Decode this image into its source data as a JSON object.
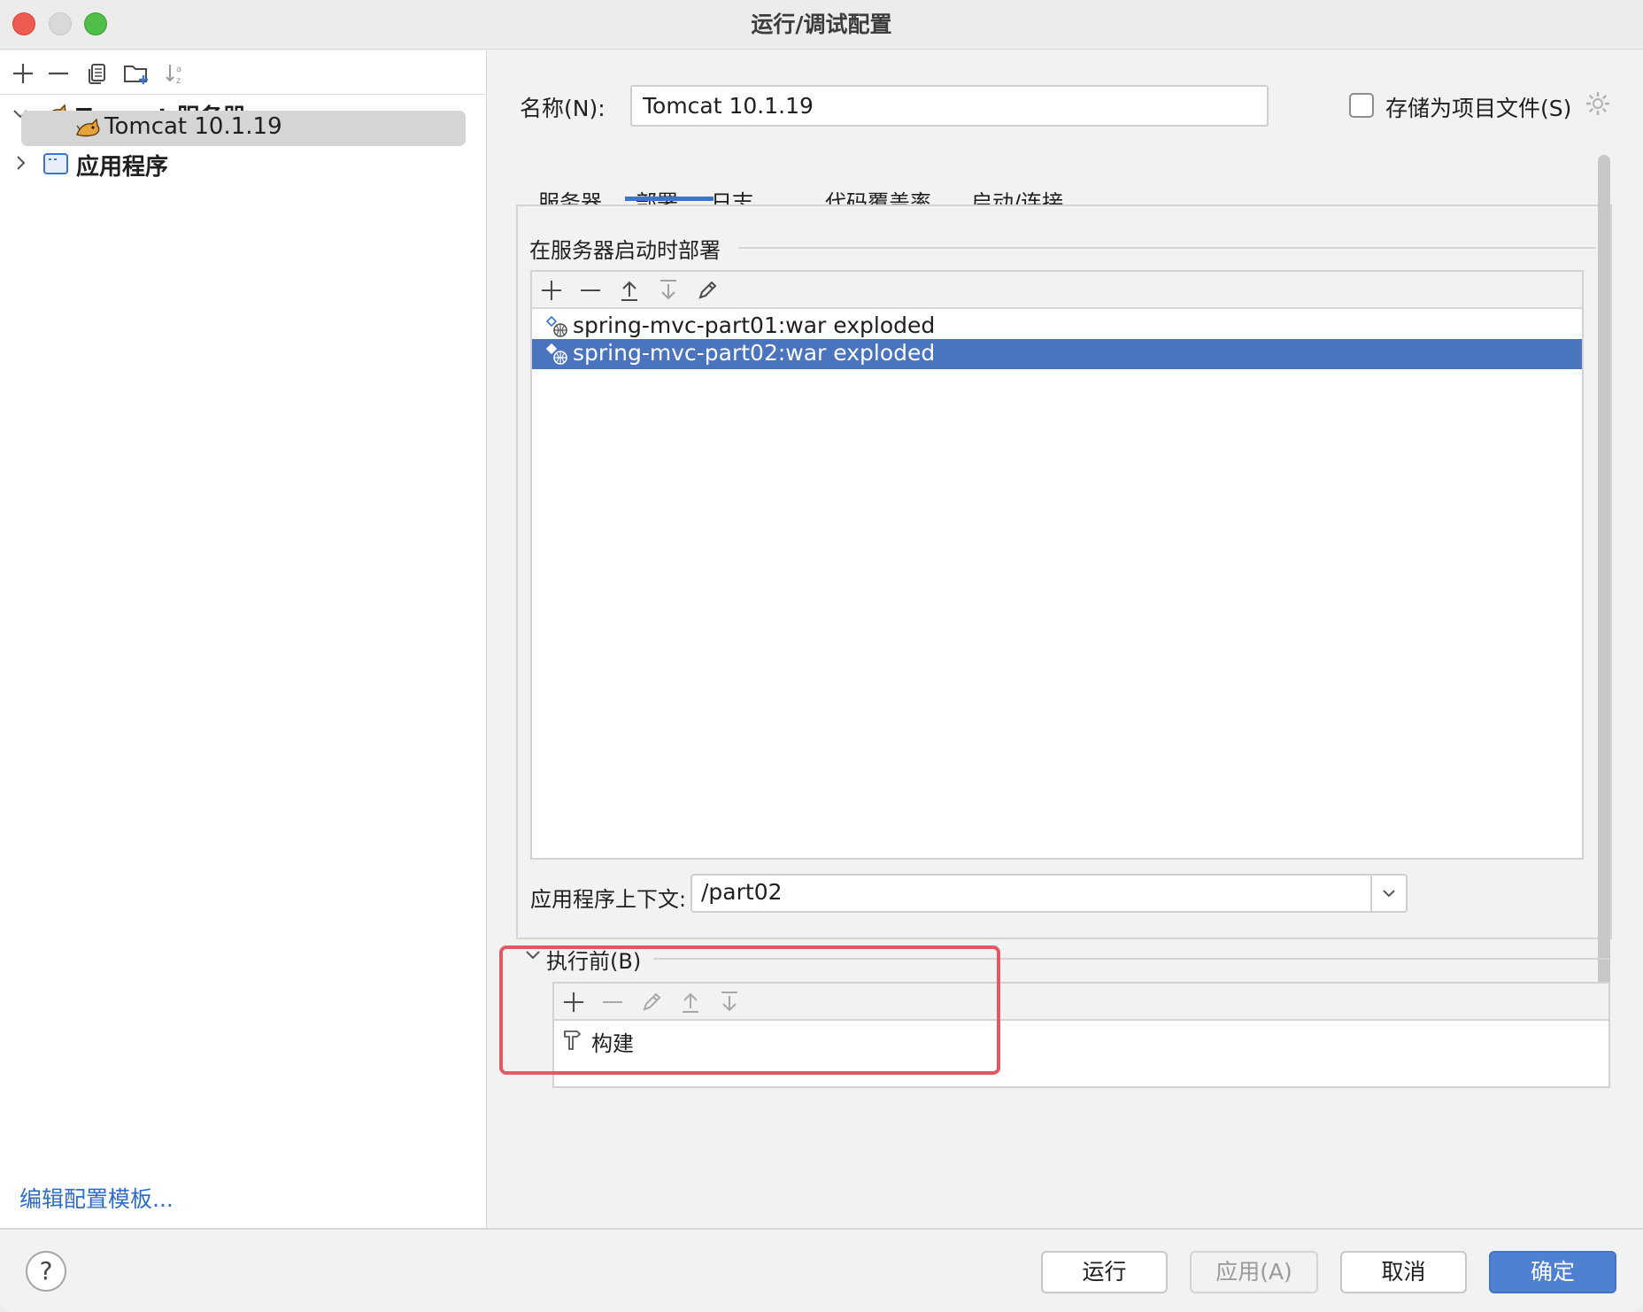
{
  "window": {
    "title": "运行/调试配置"
  },
  "left_panel": {
    "tree": {
      "tomcat_group": "Tomcat 服务器",
      "tomcat_item": "Tomcat 10.1.19",
      "app_group": "应用程序"
    },
    "edit_templates_link": "编辑配置模板..."
  },
  "config": {
    "name_label": "名称(N):",
    "name_value": "Tomcat 10.1.19",
    "store_label": "存储为项目文件(S)",
    "store_checked": false
  },
  "tabs": [
    "服务器",
    "部署",
    "日志",
    "代码覆盖率",
    "启动/连接"
  ],
  "active_tab": "部署",
  "deploy": {
    "section_title": "在服务器启动时部署",
    "artifacts": [
      "spring-mvc-part01:war exploded",
      "spring-mvc-part02:war exploded"
    ],
    "selected_index": 1,
    "context_label": "应用程序上下文:",
    "context_value": "/part02"
  },
  "before_launch": {
    "label": "执行前(B)",
    "tasks": [
      "构建"
    ]
  },
  "footer": {
    "help": "?",
    "run": "运行",
    "apply": "应用(A)",
    "cancel": "取消",
    "ok": "确定"
  },
  "colors": {
    "accent": "#3b74d1",
    "selection": "#4a74bd",
    "highlight_box": "#e05a66",
    "link": "#2f6cc8",
    "primary_button": "#4f80d1"
  }
}
